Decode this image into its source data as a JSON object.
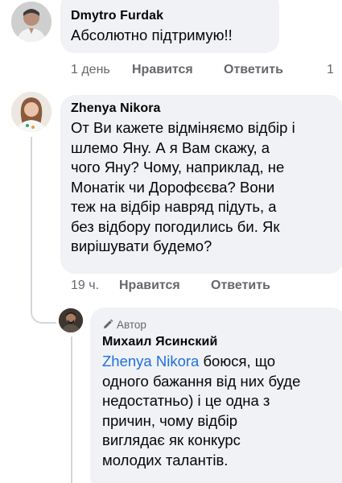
{
  "comments": [
    {
      "author": "Dmytro Furdak",
      "text": "Абсолютно підтримую!!",
      "time": "1 день",
      "like_label": "Нравится",
      "reply_label": "Ответить",
      "reaction_count": "1"
    },
    {
      "author": "Zhenya Nikora",
      "text": "От Ви кажете відміняємо відбір і\nшлемо Яну. А я Вам скажу, а\nчого Яну? Чому, наприклад, не\nМонатік чи Дорофєєва? Вони\nтеж на відбір навряд підуть, а\nбез відбору погодились би. Як\nвирішувати будемо?",
      "time": "19 ч.",
      "like_label": "Нравится",
      "reply_label": "Ответить"
    }
  ],
  "reply": {
    "badge": "Автор",
    "author": "Михаил Ясинский",
    "mention": "Zhenya Nikora",
    "text": " боюся, що\nодного бажання від них буде\nнедостатньо) і це одна з\nпричин, чому відбір\nвиглядає як конкурс\nмолодих талантів."
  },
  "colors": {
    "bubble": "#f0f2f5",
    "link": "#216fdb",
    "meta": "#65676b",
    "text": "#050505"
  },
  "icons": [
    "pencil-icon"
  ]
}
